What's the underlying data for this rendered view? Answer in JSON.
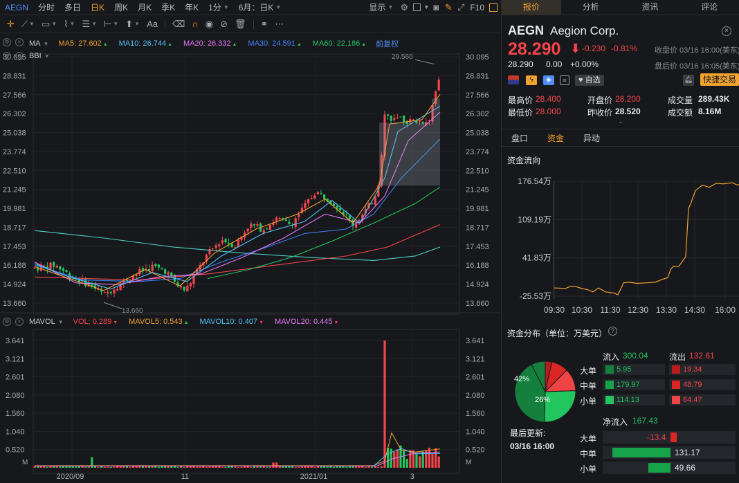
{
  "colors": {
    "up": "#f5454b",
    "down": "#22c55e",
    "accent": "#f2a22e",
    "link": "#4f8ef7"
  },
  "top_tabs": {
    "ticker": "AEGN",
    "items": [
      "分时",
      "多日",
      "日K",
      "周K",
      "月K",
      "季K",
      "年K",
      "1分",
      "6月：日K"
    ],
    "active": "日K",
    "display": "显示",
    "fio": "F10"
  },
  "toolbar": {
    "text_tool": "Aa"
  },
  "ma_legend": {
    "label": "MA",
    "items": [
      {
        "name": "MA5: 27.602",
        "color": "#f2a22e"
      },
      {
        "name": "MA10: 26.744",
        "color": "#4fc3f7"
      },
      {
        "name": "MA20: 26.332",
        "color": "#e879f9"
      },
      {
        "name": "MA30: 24.591",
        "color": "#3b82f6"
      },
      {
        "name": "MA60: 22.186",
        "color": "#22c55e"
      }
    ],
    "restore": "前复权",
    "bbi": "BBI"
  },
  "vol_legend": {
    "label": "MAVOL",
    "items": [
      {
        "name": "VOL: 0.289",
        "color": "#f5454b"
      },
      {
        "name": "MAVOL5: 0.543",
        "color": "#f2a22e"
      },
      {
        "name": "MAVOL10: 0.407",
        "color": "#4fc3f7"
      },
      {
        "name": "MAVOL20: 0.445",
        "color": "#e879f9"
      }
    ]
  },
  "price_axis": [
    "30.095",
    "28.831",
    "27.566",
    "26.302",
    "25.038",
    "23.774",
    "22.510",
    "21.245",
    "19.981",
    "18.717",
    "17.453",
    "16.188",
    "14.924",
    "13.660"
  ],
  "vol_axis": [
    "3.641",
    "3.121",
    "2.601",
    "2.080",
    "1.560",
    "1.040",
    "0.520"
  ],
  "vol_unit": "M",
  "x_axis": [
    "2020/09",
    "11",
    "2021/01",
    "3"
  ],
  "annotations": {
    "high": "29.560",
    "low": "13.660"
  },
  "quote": {
    "tabs": [
      "报价",
      "分析",
      "资讯",
      "评论"
    ],
    "active_tab": "报价",
    "symbol": "AEGN",
    "name": "Aegion Corp.",
    "price": "28.290",
    "change": "-0.230",
    "change_pct": "-0.81%",
    "close_label": "收盘价 03/16 16:00(美东)",
    "after_price": "28.290",
    "after_change": "0.00",
    "after_pct": "+0.00%",
    "after_label": "盘后价 03/16 16:05(美东)",
    "watch": "自选",
    "fast_trade": "快捷交易",
    "stats": [
      {
        "label": "最高价",
        "value": "28.400",
        "cls": "red"
      },
      {
        "label": "开盘价",
        "value": "28.200",
        "cls": "red"
      },
      {
        "label": "成交量",
        "value": "289.43K",
        "cls": "white"
      },
      {
        "label": "最低价",
        "value": "28.000",
        "cls": "red"
      },
      {
        "label": "昨收价",
        "value": "28.520",
        "cls": "white"
      },
      {
        "label": "成交额",
        "value": "8.16M",
        "cls": "white"
      }
    ]
  },
  "sub_tabs": {
    "items": [
      "盘口",
      "资金",
      "异动"
    ],
    "active": "资金"
  },
  "flow": {
    "title": "资金流向",
    "y_labels": [
      "176.54万",
      "109.19万",
      "41.83万",
      "-25.53万"
    ],
    "x_labels": [
      "09:30",
      "10:30",
      "11:30",
      "12:30",
      "13:30",
      "14:30",
      "16:00"
    ]
  },
  "distribution": {
    "title": "资金分布（单位：万美元）",
    "pct_big": "42%",
    "pct_small": "26%",
    "inflow_label": "流入",
    "inflow": "300.04",
    "outflow_label": "流出",
    "outflow": "132.61",
    "rows": [
      {
        "label": "大单",
        "in": "5.95",
        "out": "19.34"
      },
      {
        "label": "中单",
        "in": "179.97",
        "out": "48.79"
      },
      {
        "label": "小单",
        "in": "114.13",
        "out": "64.47"
      }
    ],
    "updated_label": "最后更新:",
    "updated": "03/16 16:00",
    "net_label": "净流入",
    "net": "167.43",
    "net_rows": [
      {
        "label": "大单",
        "value": "-13.4"
      },
      {
        "label": "中单",
        "value": "131.17"
      },
      {
        "label": "小单",
        "value": "49.66"
      }
    ]
  }
}
